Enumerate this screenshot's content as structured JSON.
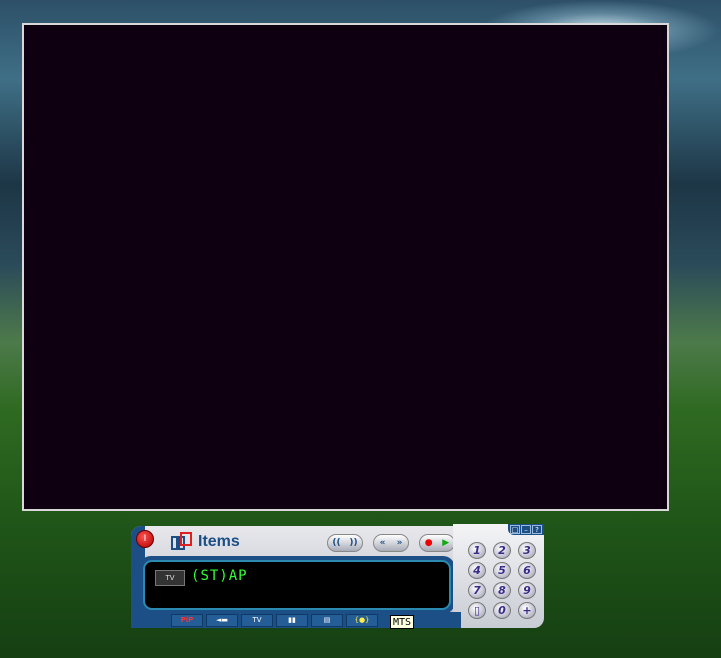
{
  "player": {
    "logo_text": "Items",
    "power_label": "I",
    "transport": {
      "vol_down": "((",
      "vol_up": "))",
      "prev": "«",
      "next": "»",
      "record": "●",
      "play": "▶"
    },
    "window_buttons": [
      "□",
      "–",
      "?"
    ],
    "display": {
      "source_label": "TV",
      "stereo": "ST",
      "mode": "AP"
    },
    "keypad": [
      "1",
      "2",
      "3",
      "4",
      "5",
      "6",
      "7",
      "8",
      "9",
      "▯",
      "0",
      "+"
    ],
    "toolbar": [
      "PiP",
      "◄▬",
      "TV",
      "▮▮",
      "▤",
      "{●}"
    ],
    "tooltip": "MTS"
  }
}
